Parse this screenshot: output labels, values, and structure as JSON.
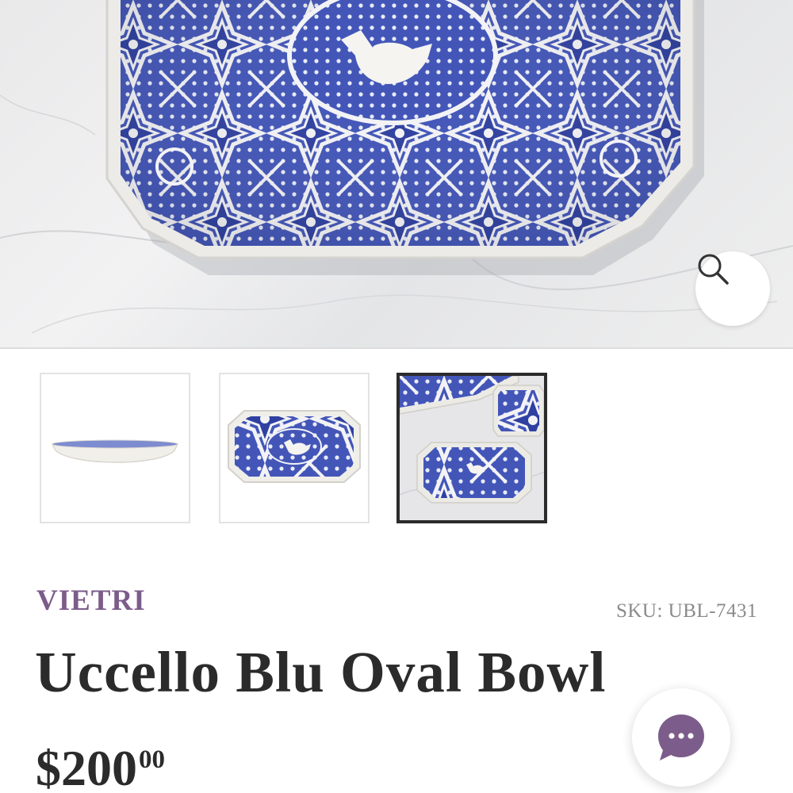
{
  "product": {
    "brand": "VIETRI",
    "sku": "SKU: UBL-7431",
    "title": "Uccello Blu Oval Bowl",
    "price_main": "$200",
    "price_cents": "00"
  },
  "colors": {
    "brand": "#7c5c8a",
    "pattern_blue": "#3d4fb0",
    "title_text": "#2b2b2b",
    "sku_text": "#8a8a8a",
    "chat_icon": "#7c5c8a"
  },
  "icons": {
    "zoom": "magnifier-icon",
    "chat": "chat-bubble-icon"
  },
  "gallery": {
    "thumbnails": [
      {
        "view": "side"
      },
      {
        "view": "top"
      },
      {
        "view": "lifestyle",
        "selected": true
      }
    ]
  }
}
